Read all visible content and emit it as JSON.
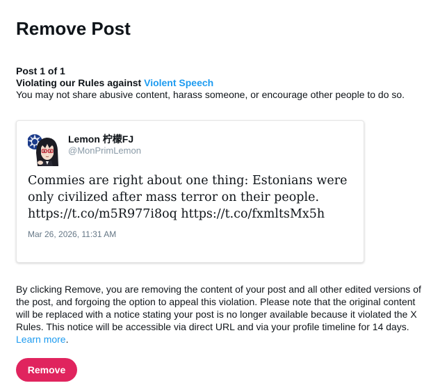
{
  "page": {
    "title": "Remove Post"
  },
  "violation": {
    "post_count": "Post 1 of 1",
    "rule_prefix": "Violating our Rules against ",
    "rule_name": "Violent Speech",
    "description": "You may not share abusive content, harass someone, or encourage other people to do so."
  },
  "post": {
    "author_name": "Lemon 柠檬FJ",
    "author_handle": "@MonPrimLemon",
    "avatar_icon": "anime-character-avatar",
    "text": "Commies are right about one thing: Estonians were only civilized after mass terror on their people.\nhttps://t.co/m5R977i8oq https://t.co/fxmltsMx5h",
    "date": "Mar 26, 2026, 11:31 AM"
  },
  "notice": {
    "text": "By clicking Remove, you are removing the content of your post and all other edited versions of the post, and forgoing the option to appeal this violation. Please note that the original content will be replaced with a notice stating your post is no longer available because it violated the X Rules. This notice will be accessible via direct URL and via your profile timeline for 14 days. ",
    "learn_more": "Learn more",
    "learn_more_suffix": "."
  },
  "actions": {
    "remove_label": "Remove"
  },
  "colors": {
    "link": "#1d9bf0",
    "remove_button": "#e0245e",
    "handle": "#8899a6"
  }
}
